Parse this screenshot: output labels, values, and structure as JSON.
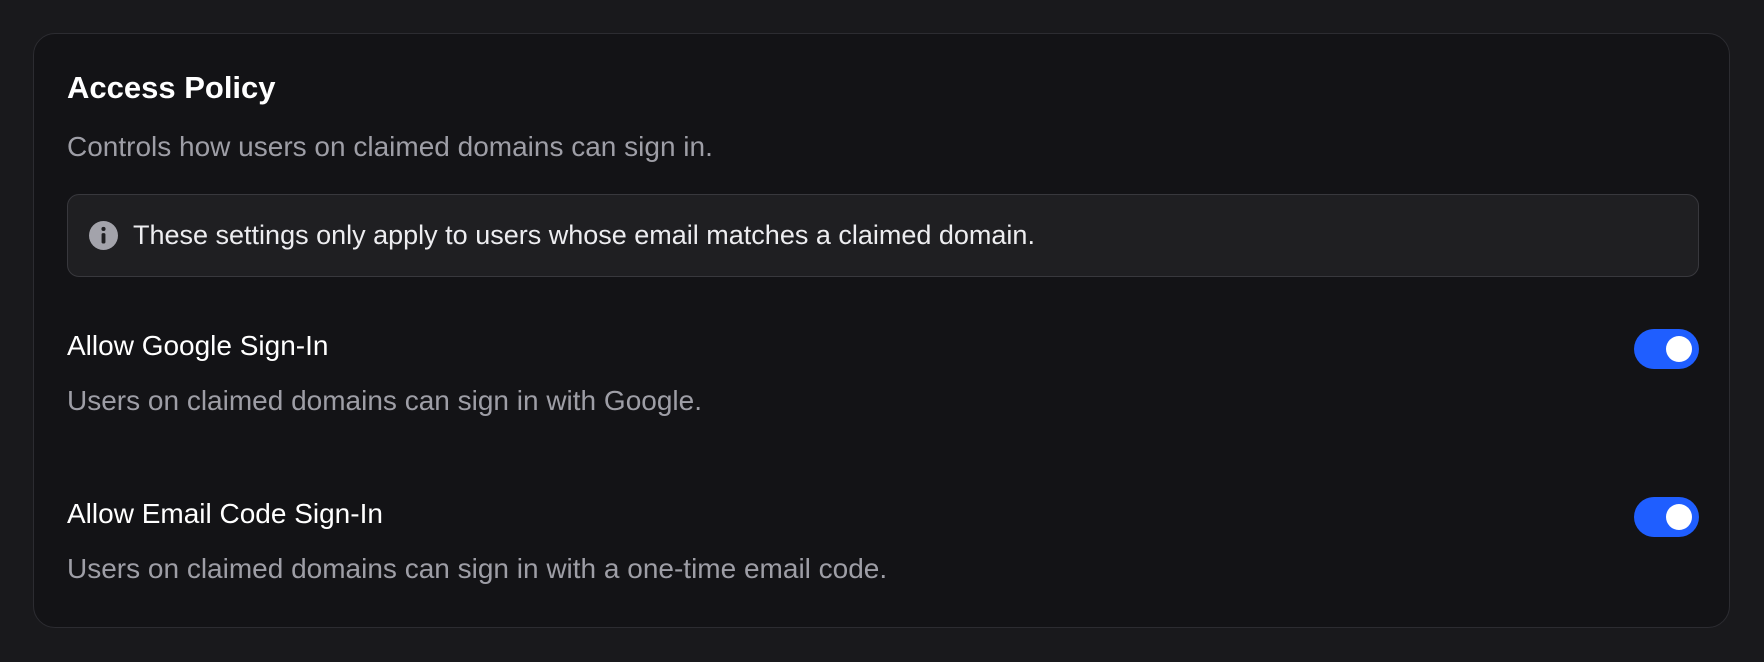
{
  "card": {
    "title": "Access Policy",
    "subtitle": "Controls how users on claimed domains can sign in."
  },
  "notice": {
    "icon": "info-icon",
    "text": "These settings only apply to users whose email matches a claimed domain."
  },
  "settings": [
    {
      "label": "Allow Google Sign-In",
      "description": "Users on claimed domains can sign in with Google.",
      "enabled": true
    },
    {
      "label": "Allow Email Code Sign-In",
      "description": "Users on claimed domains can sign in with a one-time email code.",
      "enabled": true
    }
  ],
  "colors": {
    "background": "#19191c",
    "card": "#131316",
    "accent": "#1f5eff",
    "text_primary": "#ffffff",
    "text_secondary": "#9e9ea6"
  }
}
